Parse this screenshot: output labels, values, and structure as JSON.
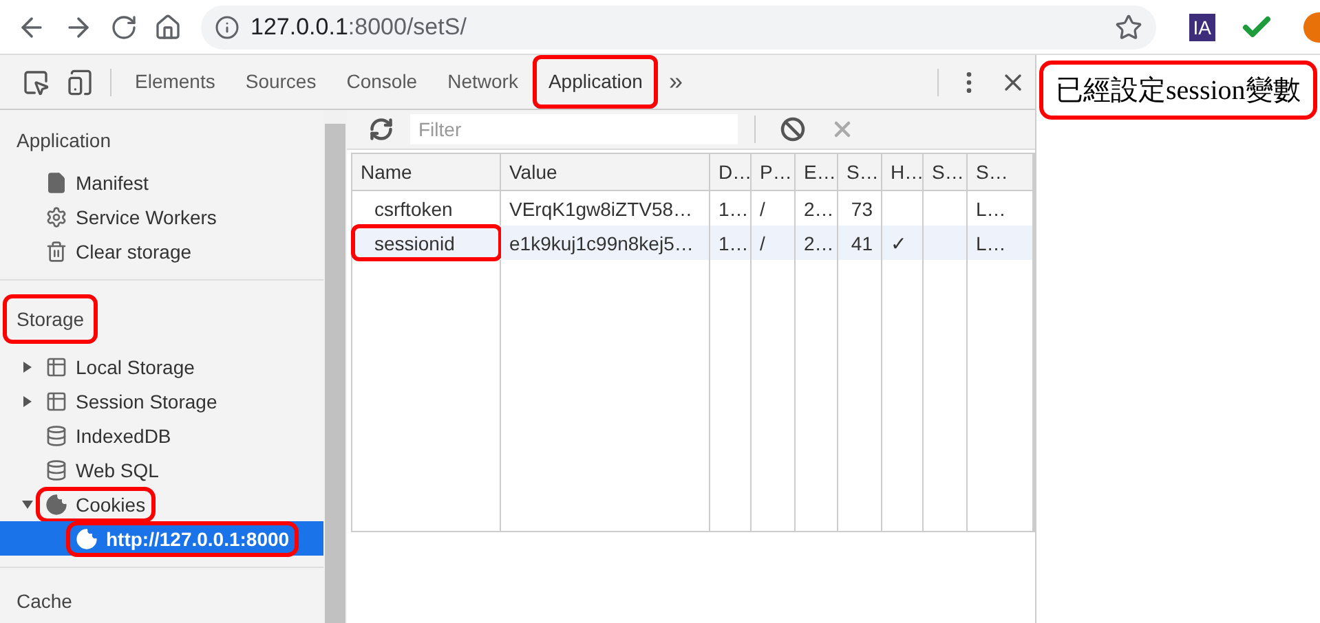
{
  "browser": {
    "url_host": "127.0.0.1",
    "url_rest": ":8000/setS/",
    "extension_badge": "IA"
  },
  "devtools": {
    "tabs": [
      {
        "label": "Elements",
        "selected": false,
        "highlighted": false
      },
      {
        "label": "Sources",
        "selected": false,
        "highlighted": false
      },
      {
        "label": "Console",
        "selected": false,
        "highlighted": false
      },
      {
        "label": "Network",
        "selected": false,
        "highlighted": false
      },
      {
        "label": "Application",
        "selected": true,
        "highlighted": true
      }
    ],
    "overflow": "»"
  },
  "sidebar": {
    "sections": [
      {
        "title": "Application",
        "highlighted": false,
        "items": [
          {
            "label": "Manifest",
            "kind": "file",
            "selected": false,
            "highlighted": false
          },
          {
            "label": "Service Workers",
            "kind": "gear",
            "selected": false,
            "highlighted": false
          },
          {
            "label": "Clear storage",
            "kind": "trash",
            "selected": false,
            "highlighted": false
          }
        ]
      },
      {
        "title": "Storage",
        "highlighted": true,
        "items": [
          {
            "label": "Local Storage",
            "kind": "grid",
            "expanded": false,
            "selected": false,
            "highlighted": false
          },
          {
            "label": "Session Storage",
            "kind": "grid",
            "expanded": false,
            "selected": false,
            "highlighted": false
          },
          {
            "label": "IndexedDB",
            "kind": "database",
            "selected": false,
            "highlighted": false
          },
          {
            "label": "Web SQL",
            "kind": "database",
            "selected": false,
            "highlighted": false
          },
          {
            "label": "Cookies",
            "kind": "cookie",
            "expanded": true,
            "selected": false,
            "highlighted": true,
            "children": [
              {
                "label": "http://127.0.0.1:8000",
                "kind": "cookie",
                "selected": true,
                "highlighted": true
              }
            ]
          }
        ]
      },
      {
        "title": "Cache",
        "highlighted": false
      }
    ]
  },
  "cookies": {
    "filter": {
      "placeholder": "Filter"
    },
    "columns": [
      "Name",
      "Value",
      "D…",
      "P…",
      "E…",
      "S…",
      "H…",
      "S…",
      "S…"
    ],
    "rows": [
      {
        "cells": [
          "csrftoken",
          "VErqK1gw8iZTV58…",
          "1…",
          "/",
          "2…",
          "73",
          "",
          "",
          "L…"
        ],
        "selected": false,
        "highlighted": false
      },
      {
        "cells": [
          "sessionid",
          "e1k9kuj1c99n8kej5…",
          "1…",
          "/",
          "2…",
          "41",
          "✓",
          "",
          "L…"
        ],
        "selected": true,
        "highlighted": true
      }
    ]
  },
  "page": {
    "message": "已經設定session變數",
    "highlighted": true
  }
}
